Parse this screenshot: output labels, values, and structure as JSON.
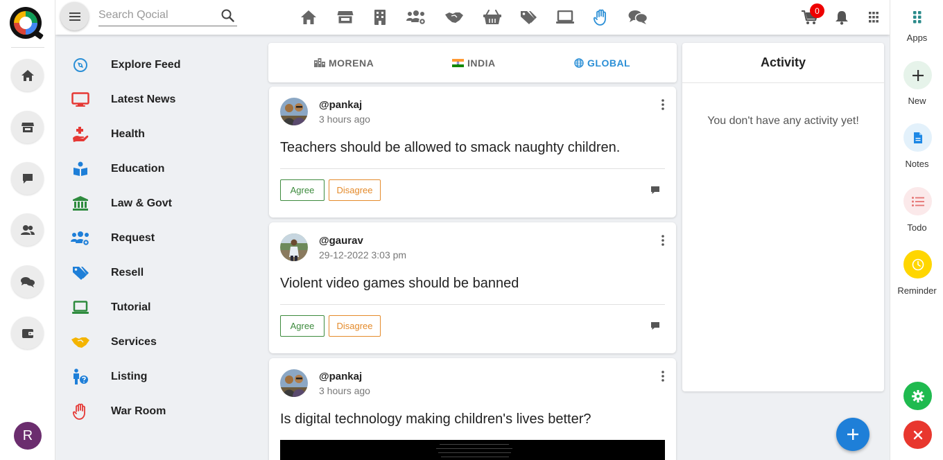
{
  "search": {
    "placeholder": "Search Qocial"
  },
  "cart": {
    "count": "0"
  },
  "avatar_letter": "R",
  "sidebar": {
    "items": [
      {
        "label": "Explore Feed",
        "icon": "compass-icon"
      },
      {
        "label": "Latest News",
        "icon": "monitor-icon"
      },
      {
        "label": "Health",
        "icon": "hand-medical-icon"
      },
      {
        "label": "Education",
        "icon": "book-reader-icon"
      },
      {
        "label": "Law & Govt",
        "icon": "landmark-icon"
      },
      {
        "label": "Request",
        "icon": "users-cog-icon"
      },
      {
        "label": "Resell",
        "icon": "tags-icon"
      },
      {
        "label": "Tutorial",
        "icon": "laptop-icon"
      },
      {
        "label": "Services",
        "icon": "handshake-icon"
      },
      {
        "label": "Listing",
        "icon": "person-question-icon"
      },
      {
        "label": "War Room",
        "icon": "raised-hand-icon"
      }
    ]
  },
  "tabs": [
    {
      "label": "MORENA",
      "active": false
    },
    {
      "label": "INDIA",
      "active": false
    },
    {
      "label": "GLOBAL",
      "active": true
    }
  ],
  "posts": [
    {
      "user": "@pankaj",
      "time": "3 hours ago",
      "text": "Teachers should be allowed to smack naughty children.",
      "agree": "Agree",
      "disagree": "Disagree"
    },
    {
      "user": "@gaurav",
      "time": "29-12-2022 3:03 pm",
      "text": "Violent video games should be banned",
      "agree": "Agree",
      "disagree": "Disagree"
    },
    {
      "user": "@pankaj",
      "time": "3 hours ago",
      "text": "Is digital technology making children's lives better?"
    }
  ],
  "activity": {
    "title": "Activity",
    "empty": "You don't have any activity yet!"
  },
  "right_rail": {
    "apps": "Apps",
    "new": "New",
    "notes": "Notes",
    "todo": "Todo",
    "reminder": "Reminder"
  },
  "colors": {
    "accent": "#2b8fd6",
    "agree": "#3c8a3c",
    "disagree": "#e48a2a",
    "fab": "#1e7fd8",
    "settings": "#1fba4f",
    "close": "#e8372e",
    "reminder": "#ffd600"
  }
}
